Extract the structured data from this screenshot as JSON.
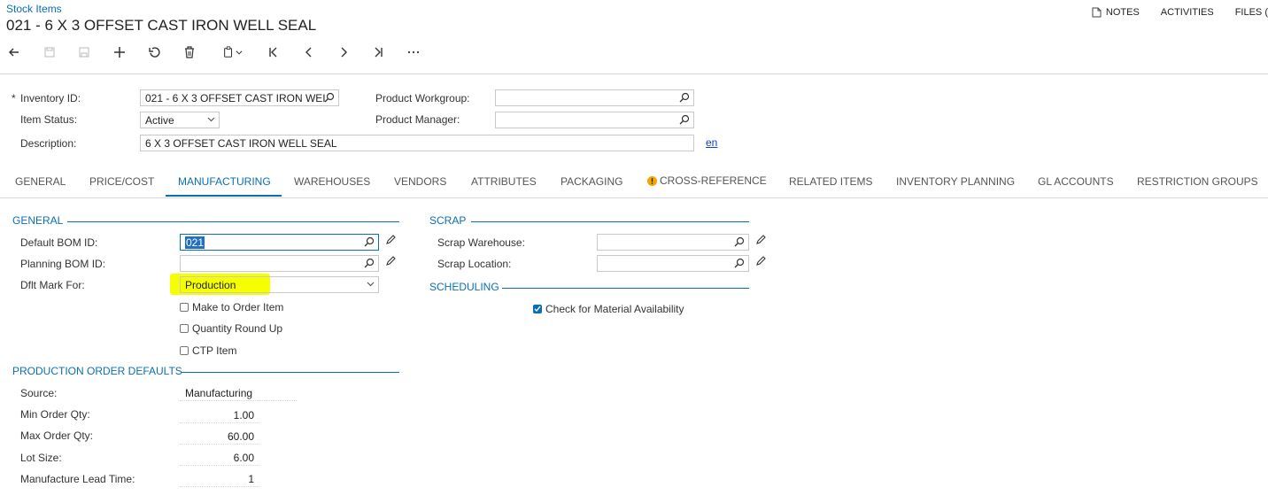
{
  "header": {
    "breadcrumb": "Stock Items",
    "title": "021 - 6 X 3 OFFSET CAST IRON WELL SEAL",
    "links": {
      "notes": "NOTES",
      "activities": "ACTIVITIES",
      "files": "FILES ("
    }
  },
  "toolbar": {
    "buttons": [
      "back-icon",
      "save-close-icon",
      "save-icon",
      "add-icon",
      "undo-icon",
      "delete-icon",
      "copy-paste-icon",
      "first-record-icon",
      "previous-icon",
      "next-icon",
      "last-record-icon",
      "more-icon"
    ]
  },
  "summary": {
    "required_mark": "*",
    "inventory_id_label": "Inventory ID:",
    "inventory_id_value": "021 - 6 X 3 OFFSET CAST IRON WEI",
    "item_status_label": "Item Status:",
    "item_status_value": "Active",
    "description_label": "Description:",
    "description_value": "6 X 3 OFFSET CAST IRON WELL SEAL",
    "product_workgroup_label": "Product Workgroup:",
    "product_workgroup_value": "",
    "product_manager_label": "Product Manager:",
    "product_manager_value": "",
    "language_link": "en"
  },
  "tabs": [
    {
      "label": "GENERAL"
    },
    {
      "label": "PRICE/COST"
    },
    {
      "label": "MANUFACTURING"
    },
    {
      "label": "WAREHOUSES"
    },
    {
      "label": "VENDORS"
    },
    {
      "label": "ATTRIBUTES"
    },
    {
      "label": "PACKAGING"
    },
    {
      "label": "CROSS-REFERENCE"
    },
    {
      "label": "RELATED ITEMS"
    },
    {
      "label": "INVENTORY PLANNING"
    },
    {
      "label": "GL ACCOUNTS"
    },
    {
      "label": "RESTRICTION GROUPS"
    }
  ],
  "active_tab": "MANUFACTURING",
  "general": {
    "heading": "GENERAL",
    "default_bom_label": "Default BOM ID:",
    "default_bom_value": "021",
    "planning_bom_label": "Planning BOM ID:",
    "planning_bom_value": "",
    "dflt_mark_label": "Dflt Mark For:",
    "dflt_mark_value": "Production",
    "make_to_order": "Make to Order Item",
    "quantity_round_up": "Quantity Round Up",
    "ctp_item": "CTP Item"
  },
  "scrap": {
    "heading": "SCRAP",
    "warehouse_label": "Scrap Warehouse:",
    "warehouse_value": "",
    "location_label": "Scrap Location:",
    "location_value": ""
  },
  "scheduling": {
    "heading": "SCHEDULING",
    "check_material": "Check for Material Availability",
    "check_material_checked": true
  },
  "production": {
    "heading": "PRODUCTION ORDER DEFAULTS",
    "source_label": "Source:",
    "source_value": "Manufacturing",
    "min_qty_label": "Min Order Qty:",
    "min_qty_value": "1.00",
    "max_qty_label": "Max Order Qty:",
    "max_qty_value": "60.00",
    "lot_size_label": "Lot Size:",
    "lot_size_value": "6.00",
    "lead_time_label": "Manufacture Lead Time:",
    "lead_time_value": "1"
  },
  "colors": {
    "accent": "#0b6fb5",
    "highlight": "#f5ff00",
    "warning": "#f0a800"
  }
}
